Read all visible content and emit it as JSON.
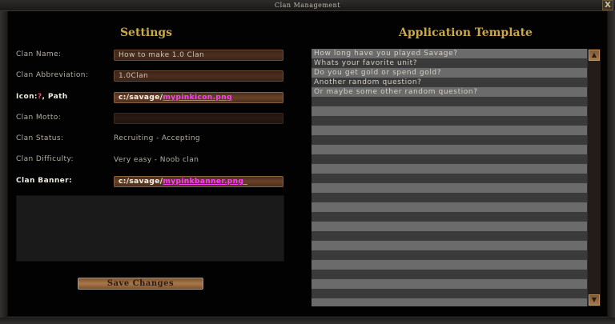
{
  "window": {
    "title": "Clan Management",
    "close_label": "X"
  },
  "settings": {
    "heading": "Settings",
    "clan_name": {
      "label": "Clan Name:",
      "value": "How to make 1.0 Clan"
    },
    "clan_abbreviation": {
      "label": "Clan Abbreviation:",
      "value": "1.0Clan"
    },
    "icon": {
      "label_prefix": "Icon:",
      "icon_glyph": "?",
      "label_suffix": ", Path",
      "value_prefix": "c:/savage/",
      "value_file": "mypinkicon.png"
    },
    "clan_motto": {
      "label": "Clan Motto:",
      "value": ""
    },
    "clan_status": {
      "label": "Clan Status:",
      "value": "Recruiting - Accepting"
    },
    "clan_difficulty": {
      "label": "Clan Difficulty:",
      "value": "Very easy - Noob clan"
    },
    "clan_banner": {
      "label": "Clan Banner:",
      "value_prefix": "c:/savage/",
      "value_file": "mypinkbanner.png"
    },
    "save_label": "Save Changes"
  },
  "template": {
    "heading": "Application Template",
    "rows": [
      "How long have you played Savage?",
      "Whats your favorite unit?",
      "Do you get gold or spend gold?",
      "Another random question?",
      "Or maybe some other random question?",
      "",
      "",
      "",
      "",
      "",
      "",
      "",
      "",
      "",
      "",
      "",
      "",
      "",
      "",
      "",
      "",
      "",
      "",
      "",
      "",
      "",
      ""
    ],
    "cursor": "_"
  },
  "colors": {
    "heading": "#c9a84a",
    "link": "#ff3cff",
    "field": "#4c2e1e"
  },
  "icons": {
    "close": "close-icon",
    "scroll_up": "arrow-up-icon",
    "scroll_down": "arrow-down-icon",
    "question": "question-mark-icon"
  }
}
